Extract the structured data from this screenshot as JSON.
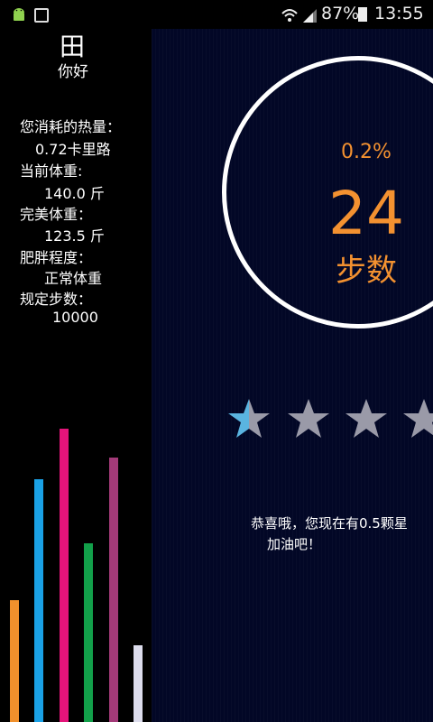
{
  "status_bar": {
    "battery_percent": "87%",
    "time": "13:55"
  },
  "profile": {
    "avatar_glyph": "田",
    "greeting": "你好"
  },
  "stats": {
    "calories_label": "您消耗的热量：",
    "calories_value": "0.72卡里路",
    "current_weight_label": "当前体重:",
    "current_weight_value": "140.0 斤",
    "ideal_weight_label": "完美体重：",
    "ideal_weight_value": "123.5 斤",
    "bmi_label": "肥胖程度：",
    "bmi_value": "正常体重",
    "goal_steps_label": "规定步数：",
    "goal_steps_value": "10000"
  },
  "progress": {
    "percent_text": "0.2%",
    "steps": "24",
    "steps_label": "步数"
  },
  "rating": {
    "stars_total_visible": 4,
    "stars_earned": 0.5
  },
  "message": {
    "congrats": "恭喜哦，您现在有0.5颗星",
    "cheer": "加油吧！"
  },
  "colors": {
    "accent": "#f39130",
    "panel_bg": "#020726",
    "bar_colors": [
      "#f0902c",
      "#1aa1e6",
      "#e4147a",
      "#12a04a",
      "#a33a78",
      "#dcdcec"
    ]
  }
}
